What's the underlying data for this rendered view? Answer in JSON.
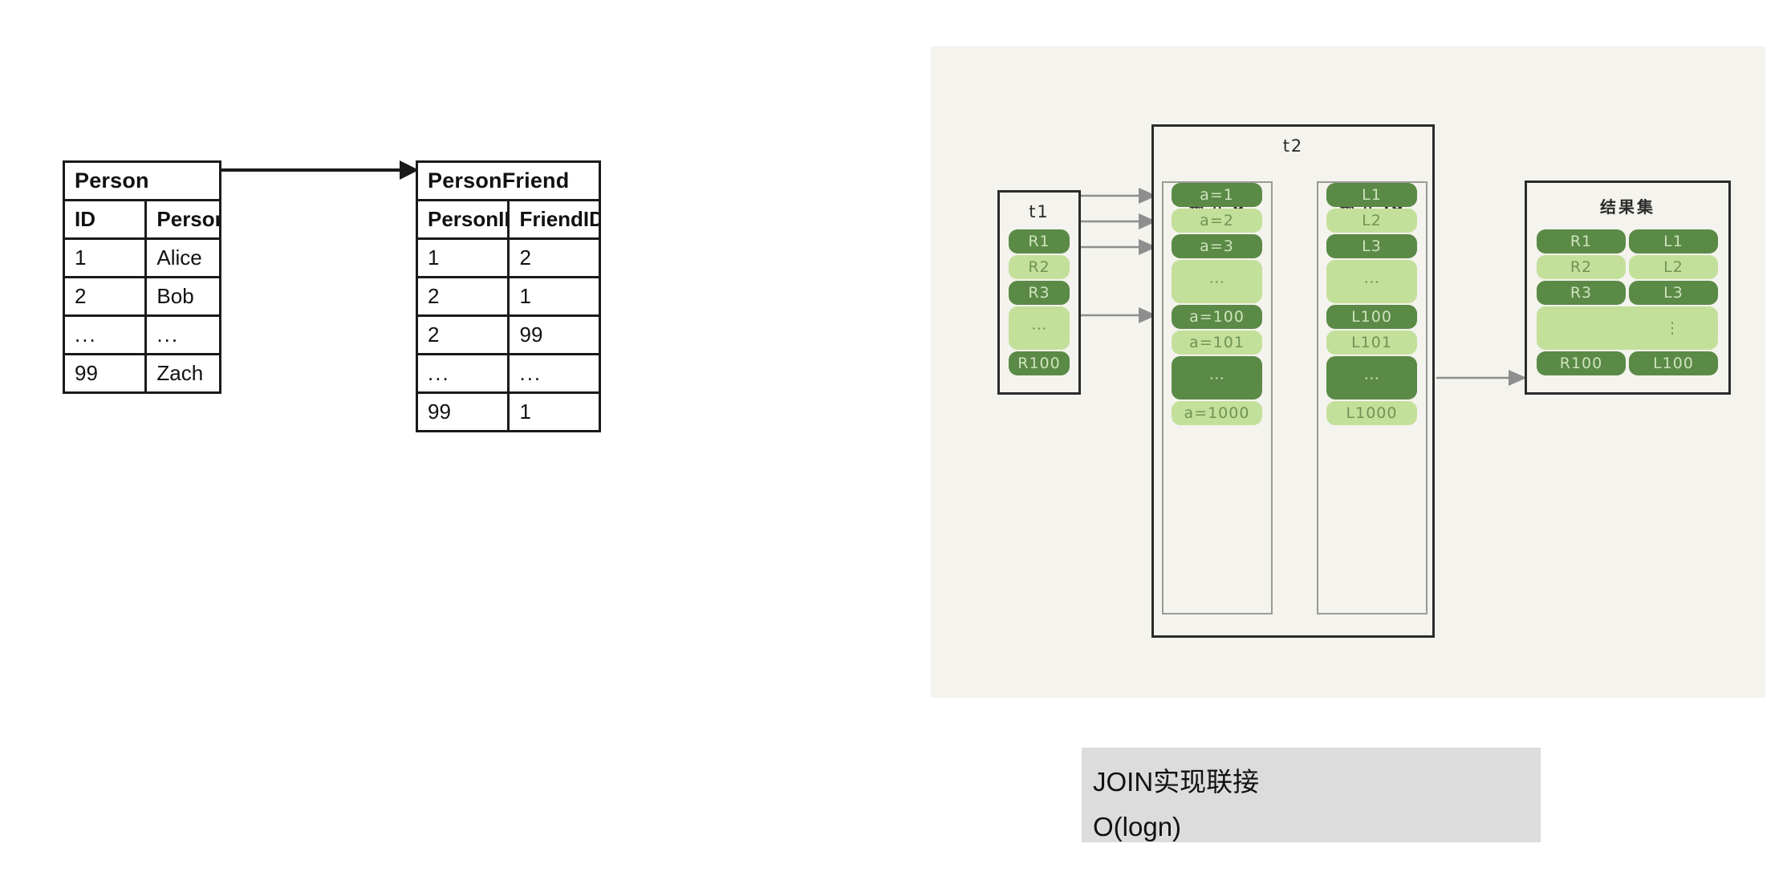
{
  "left_diagram": {
    "person_table": {
      "title": "Person",
      "headers": [
        "ID",
        "Person"
      ],
      "rows": [
        [
          "1",
          "Alice"
        ],
        [
          "2",
          "Bob"
        ],
        [
          "...",
          "..."
        ],
        [
          "99",
          "Zach"
        ]
      ]
    },
    "personfriend_table": {
      "title": "PersonFriend",
      "headers": [
        "PersonID",
        "FriendID"
      ],
      "rows": [
        [
          "1",
          "2"
        ],
        [
          "2",
          "1"
        ],
        [
          "2",
          "99"
        ],
        [
          "...",
          "..."
        ],
        [
          "99",
          "1"
        ]
      ]
    },
    "relation_arrow": "arrow-right"
  },
  "right_diagram": {
    "t1_panel": {
      "label": "t1",
      "cells": [
        {
          "text": "R1",
          "shade": "dark"
        },
        {
          "text": "R2",
          "shade": "light"
        },
        {
          "text": "R3",
          "shade": "dark"
        },
        {
          "text": "⋮",
          "shade": "light"
        },
        {
          "text": "R100",
          "shade": "dark"
        }
      ]
    },
    "t2_panel": {
      "label": "t2",
      "index_a": {
        "label": "索引 a",
        "cells": [
          {
            "text": "a=1",
            "shade": "dark"
          },
          {
            "text": "a=2",
            "shade": "light"
          },
          {
            "text": "a=3",
            "shade": "dark"
          },
          {
            "text": "⋮",
            "shade": "light"
          },
          {
            "text": "a=100",
            "shade": "dark"
          },
          {
            "text": "a=101",
            "shade": "light"
          },
          {
            "text": "⋮",
            "shade": "dark"
          },
          {
            "text": "a=1000",
            "shade": "light"
          }
        ]
      },
      "index_id": {
        "label": "索引 id",
        "cells": [
          {
            "text": "L1",
            "shade": "dark"
          },
          {
            "text": "L2",
            "shade": "light"
          },
          {
            "text": "L3",
            "shade": "dark"
          },
          {
            "text": "⋮",
            "shade": "light"
          },
          {
            "text": "L100",
            "shade": "dark"
          },
          {
            "text": "L101",
            "shade": "light"
          },
          {
            "text": "⋮",
            "shade": "dark"
          },
          {
            "text": "L1000",
            "shade": "light"
          }
        ]
      }
    },
    "result_panel": {
      "label": "结果集",
      "rows": [
        {
          "left": "R1",
          "right": "L1",
          "shade": "dark"
        },
        {
          "left": "R2",
          "right": "L2",
          "shade": "light"
        },
        {
          "left": "R3",
          "right": "L3",
          "shade": "dark"
        },
        {
          "left": "⋮",
          "right": "",
          "shade": "light"
        },
        {
          "left": "R100",
          "right": "L100",
          "shade": "dark"
        }
      ]
    }
  },
  "caption": {
    "line1": "JOIN实现联接",
    "line2": "O(logn)"
  },
  "colors": {
    "dark_green": "#5a8a46",
    "light_green": "#c3e09a",
    "panel_bg": "#f4f3ee",
    "caption_bg": "#dcdcdc",
    "outline": "#2b2b2b",
    "arrow": "#8e8e8e"
  }
}
